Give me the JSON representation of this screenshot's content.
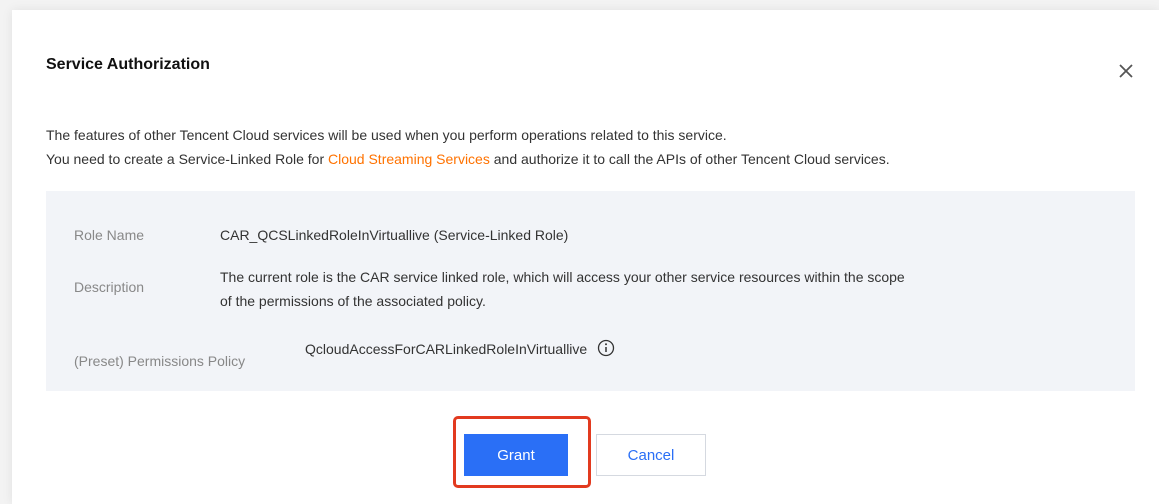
{
  "dialog": {
    "title": "Service Authorization",
    "close_icon": "close-icon",
    "intro_line1": "The features of other Tencent Cloud services will be used when you perform operations related to this service.",
    "intro_line2_prefix": "You need to create a Service-Linked Role for ",
    "intro_link": "Cloud Streaming Services",
    "intro_line2_suffix": " and authorize it to call the APIs of other Tencent Cloud services."
  },
  "role": {
    "name_label": "Role Name",
    "name_value": "CAR_QCSLinkedRoleInVirtuallive (Service-Linked Role)",
    "description_label": "Description",
    "description_line1": "The current role is the CAR service linked role, which will access your other service resources within the scope",
    "description_line2": "of the permissions of the associated policy.",
    "policy_label": "(Preset) Permissions Policy",
    "policy_value": "QcloudAccessForCARLinkedRoleInVirtuallive",
    "policy_icon": "info-icon"
  },
  "actions": {
    "grant_label": "Grant",
    "cancel_label": "Cancel"
  },
  "colors": {
    "primary": "#2a6ff6",
    "link": "#ff7200",
    "highlight": "#e23a1f",
    "panel_bg": "#f2f4f8"
  }
}
